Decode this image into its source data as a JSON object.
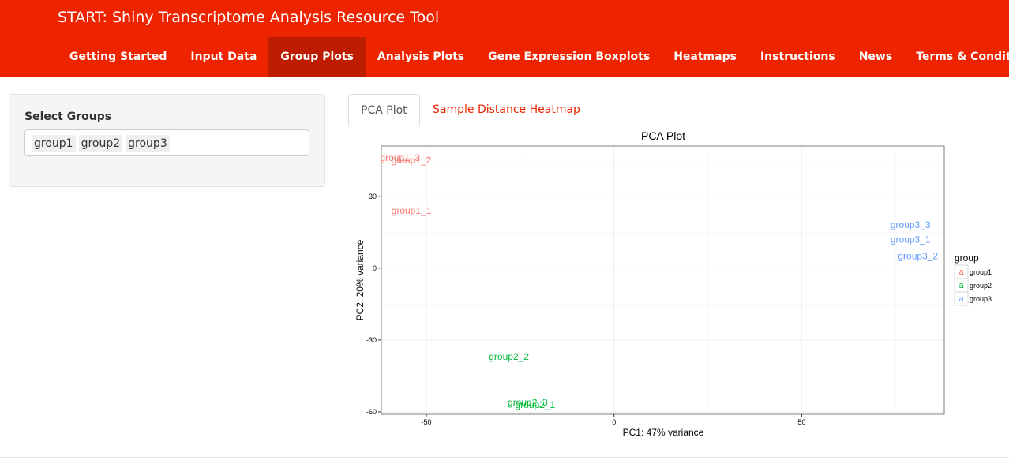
{
  "app": {
    "title": "START: Shiny Transcriptome Analysis Resource Tool"
  },
  "nav": {
    "items": [
      {
        "label": "Getting Started"
      },
      {
        "label": "Input Data"
      },
      {
        "label": "Group Plots",
        "active": true
      },
      {
        "label": "Analysis Plots"
      },
      {
        "label": "Gene Expression Boxplots"
      },
      {
        "label": "Heatmaps"
      },
      {
        "label": "Instructions"
      },
      {
        "label": "News"
      },
      {
        "label": "Terms & Conditions"
      }
    ]
  },
  "sidebar": {
    "label": "Select Groups",
    "selected": [
      "group1",
      "group2",
      "group3"
    ]
  },
  "tabs": {
    "pca": "PCA Plot",
    "heatmap": "Sample Distance Heatmap"
  },
  "colors": {
    "brand": "#ee2300",
    "group1": "#f8766d",
    "group2": "#00ba38",
    "group3": "#619cff"
  },
  "chart_data": {
    "type": "scatter",
    "title": "PCA Plot",
    "xlabel": "PC1: 47% variance",
    "ylabel": "PC2: 20% variance",
    "xlim": [
      -62,
      88
    ],
    "ylim": [
      -61,
      51
    ],
    "xticks": [
      -50,
      0,
      50
    ],
    "yticks": [
      -60,
      -30,
      0,
      30
    ],
    "grid": true,
    "legend": {
      "title": "group",
      "position": "right",
      "entries": [
        "group1",
        "group2",
        "group3"
      ],
      "key_glyph": "a"
    },
    "series": [
      {
        "name": "group1",
        "points": [
          {
            "label": "group1_3",
            "x": -57,
            "y": 46
          },
          {
            "label": "group1_2",
            "x": -54,
            "y": 45
          },
          {
            "label": "group1_1",
            "x": -54,
            "y": 24
          }
        ]
      },
      {
        "name": "group2",
        "points": [
          {
            "label": "group2_2",
            "x": -28,
            "y": -37
          },
          {
            "label": "group2_3",
            "x": -23,
            "y": -56
          },
          {
            "label": "group2_1",
            "x": -21,
            "y": -57
          }
        ]
      },
      {
        "name": "group3",
        "points": [
          {
            "label": "group3_3",
            "x": 79,
            "y": 18
          },
          {
            "label": "group3_1",
            "x": 79,
            "y": 12
          },
          {
            "label": "group3_2",
            "x": 81,
            "y": 5
          }
        ]
      }
    ]
  }
}
